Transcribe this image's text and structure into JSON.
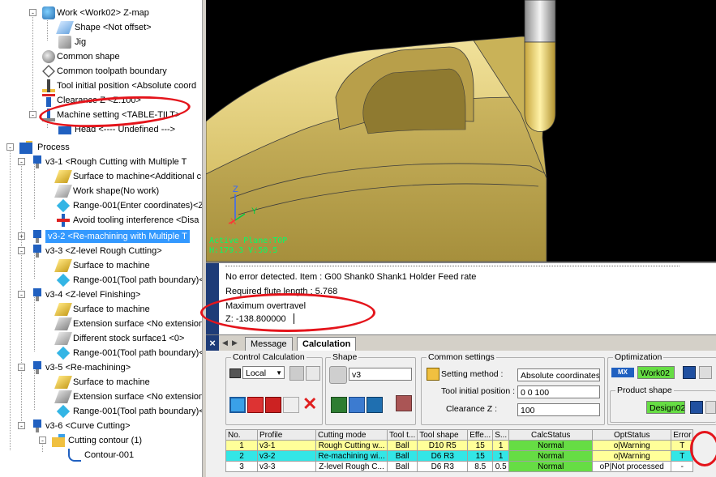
{
  "tree": {
    "items": [
      {
        "label": "Work <Work02> Z-map",
        "icon": "work-icon"
      },
      {
        "label": "Shape <Not offset>",
        "icon": "shape-icon"
      },
      {
        "label": "Jig",
        "icon": "jig-icon"
      },
      {
        "label": "Common shape",
        "icon": "common-shape-icon"
      },
      {
        "label": "Common toolpath boundary",
        "icon": "boundary-icon"
      },
      {
        "label": "Tool initial position <Absolute coord",
        "icon": "tool-position-icon"
      },
      {
        "label": "Clearance Z <Z:100>",
        "icon": "clearance-icon"
      },
      {
        "label": "Machine setting <TABLE-TILT>",
        "icon": "machine-icon"
      },
      {
        "label": "Head <---- Undefined --->",
        "icon": "head-icon"
      },
      {
        "label": "Process",
        "icon": "process-icon"
      },
      {
        "label": "v3-1 <Rough Cutting with Multiple T",
        "icon": "tool-icon"
      },
      {
        "label": "Surface to machine<Additional c",
        "icon": "surface-icon"
      },
      {
        "label": "Work shape(No work)",
        "icon": "work-shape-icon"
      },
      {
        "label": "Range-001(Enter coordinates)<Z",
        "icon": "range-icon"
      },
      {
        "label": "Avoid tooling interference <Disa",
        "icon": "avoid-icon"
      },
      {
        "label": "v3-2 <Re-machining with Multiple T",
        "icon": "tool-icon"
      },
      {
        "label": "v3-3 <Z-level Rough Cutting>",
        "icon": "tool-icon"
      },
      {
        "label": "Surface to machine",
        "icon": "surface-icon"
      },
      {
        "label": "Range-001(Tool path boundary)<",
        "icon": "range-icon"
      },
      {
        "label": "v3-4 <Z-level Finishing>",
        "icon": "tool-icon"
      },
      {
        "label": "Surface to machine",
        "icon": "surface-icon"
      },
      {
        "label": "Extension surface <No extension",
        "icon": "extension-icon"
      },
      {
        "label": "Different stock surface1 <0>",
        "icon": "stock-icon"
      },
      {
        "label": "Range-001(Tool path boundary)<",
        "icon": "range-icon"
      },
      {
        "label": "v3-5 <Re-machining>",
        "icon": "tool-icon"
      },
      {
        "label": "Surface to machine",
        "icon": "surface-icon"
      },
      {
        "label": "Extension surface <No extension",
        "icon": "extension-icon"
      },
      {
        "label": "Range-001(Tool path boundary)<",
        "icon": "range-icon"
      },
      {
        "label": "v3-6 <Curve Cutting>",
        "icon": "tool-icon"
      },
      {
        "label": "Cutting contour (1)",
        "icon": "contour-folder-icon"
      },
      {
        "label": "Contour-001",
        "icon": "contour-icon"
      }
    ]
  },
  "viewport": {
    "axis_z": "Z",
    "axis_x": "X",
    "axis_y": "Y",
    "active_plane": "Active Plane:TOP",
    "hv": "H:179.3 V:50.5"
  },
  "message": {
    "lines": [
      "No error detected. Item : G00 Shank0 Shank1 Holder Feed rate",
      "Required flute length : 5.768",
      "Maximum overtravel",
      "Z: -138.800000"
    ]
  },
  "tabs": {
    "close": "×",
    "message": "Message",
    "calculation": "Calculation"
  },
  "calc": {
    "control_calculation": "Control Calculation",
    "mode": "Local",
    "shape_label": "Shape",
    "shape_value": "v3",
    "common_settings": "Common settings",
    "setting_method_label": "Setting method :",
    "setting_method_value": "Absolute coordinates",
    "tool_initial_label": "Tool initial position :",
    "tool_initial_value": "0 0 100",
    "clearance_label": "Clearance Z :",
    "clearance_value": "100",
    "optimization": "Optimization",
    "opt_value": "Work02",
    "product_shape": "Product shape",
    "product_value": "Design02"
  },
  "table": {
    "headers": [
      "No.",
      "Profile",
      "Cutting mode",
      "Tool t...",
      "Tool shape",
      "Effe...",
      "S...",
      "CalcStatus",
      "OptStatus",
      "Error"
    ],
    "rows": [
      [
        "1",
        "v3-1",
        "Rough Cutting w...",
        "Ball",
        "D10 R5",
        "15",
        "1",
        "Normal",
        "o|Warning",
        "T"
      ],
      [
        "2",
        "v3-2",
        "Re-machining wi...",
        "Ball",
        "D6 R3",
        "15",
        "1",
        "Normal",
        "o|Warning",
        "T"
      ],
      [
        "3",
        "v3-3",
        "Z-level Rough C...",
        "Ball",
        "D6 R3",
        "8.5",
        "0.5",
        "Normal",
        "oP|Not processed",
        "-"
      ]
    ]
  },
  "colors": {
    "accent": "#3399ff",
    "model": "#e2cd7a",
    "highlight_ring": "#e4141b",
    "status_ok": "#66dd44",
    "row_warning": "#ffff99",
    "row_selected": "#33e6e6"
  }
}
